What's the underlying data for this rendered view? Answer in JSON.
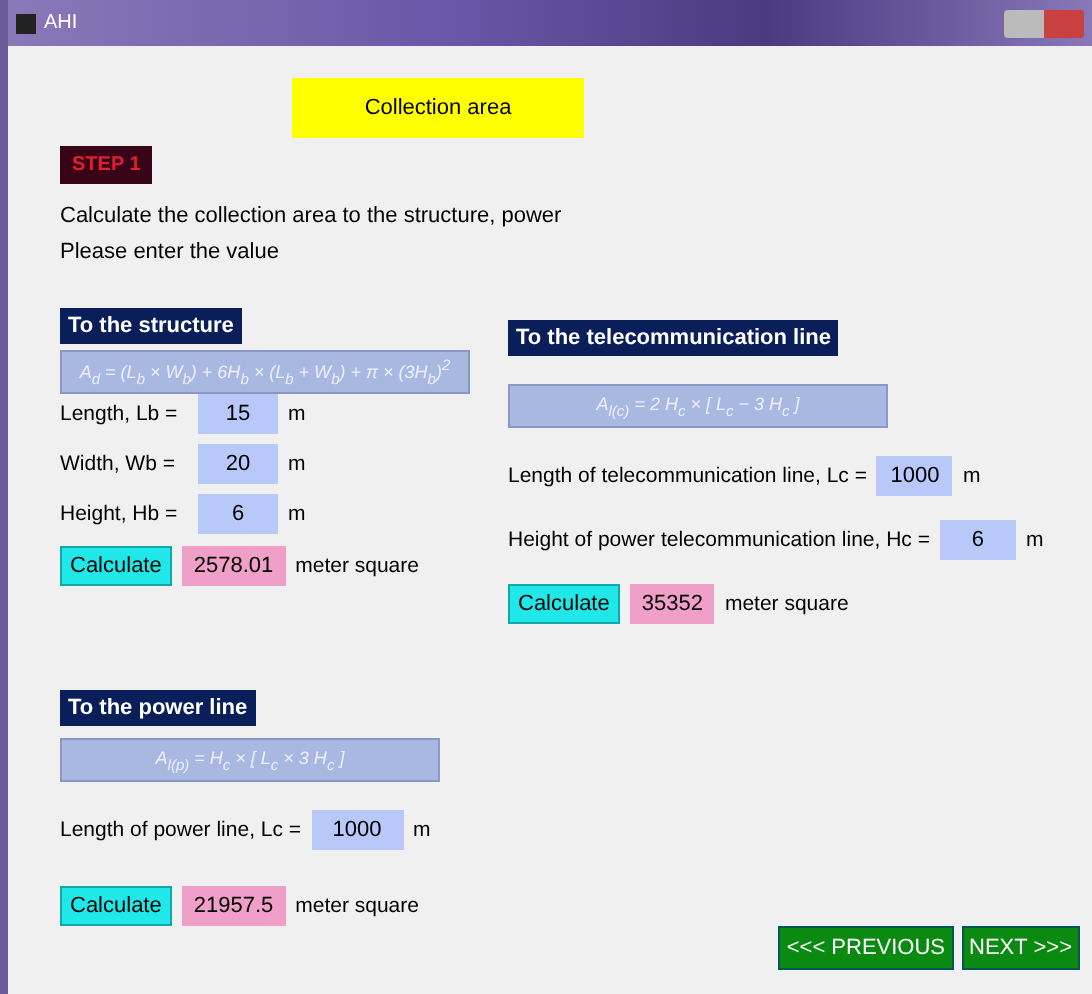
{
  "window": {
    "title": "AHI"
  },
  "banner": "Collection area",
  "step": "STEP 1",
  "instructions": [
    "Calculate the collection area to the structure, power",
    "Please enter the value"
  ],
  "sections": [
    {
      "heading": "To the structure",
      "formula": "A$_{d}$ = (L$_{b}$ × W$_{b}$) + 6H$_{b}$ × (L$_{b}$ + W$_{b}$) + π × (3H$_{b}$)$^{2}$",
      "fields": [
        {
          "label": "Length, Lb =",
          "value": "15",
          "unit": "m"
        },
        {
          "label": "Width, Wb =",
          "value": "20",
          "unit": "m"
        },
        {
          "label": "Height, Hb =",
          "value": "6",
          "unit": "m"
        }
      ],
      "button": "Calculate",
      "result": "2578.01",
      "result_unit": "meter square"
    },
    {
      "heading": "To the telecommunication line",
      "formula": "A$_{l(c)}$ = 2 H$_{c}$ × [ L$_{c}$ − 3 H$_{c}$ ]",
      "fields": [
        {
          "label": "Length of telecommunication line, Lc =",
          "value": "1000",
          "unit": "m"
        },
        {
          "label": "Height of power telecommunication line, Hc =",
          "value": "6",
          "unit": "m"
        }
      ],
      "button": "Calculate",
      "result": "35352",
      "result_unit": "meter square"
    },
    {
      "heading": "To the power line",
      "formula": "A$_{l(p)}$ = H$_{c}$ × [ L$_{c}$ × 3 H$_{c}$ ]",
      "fields": [
        {
          "label": "Length of power line, Lc =",
          "value": "1000",
          "unit": "m"
        }
      ],
      "button": "Calculate",
      "result": "21957.5",
      "result_unit": "meter square"
    }
  ],
  "nav": [
    "<<< PREVIOUS",
    "NEXT >>>"
  ]
}
